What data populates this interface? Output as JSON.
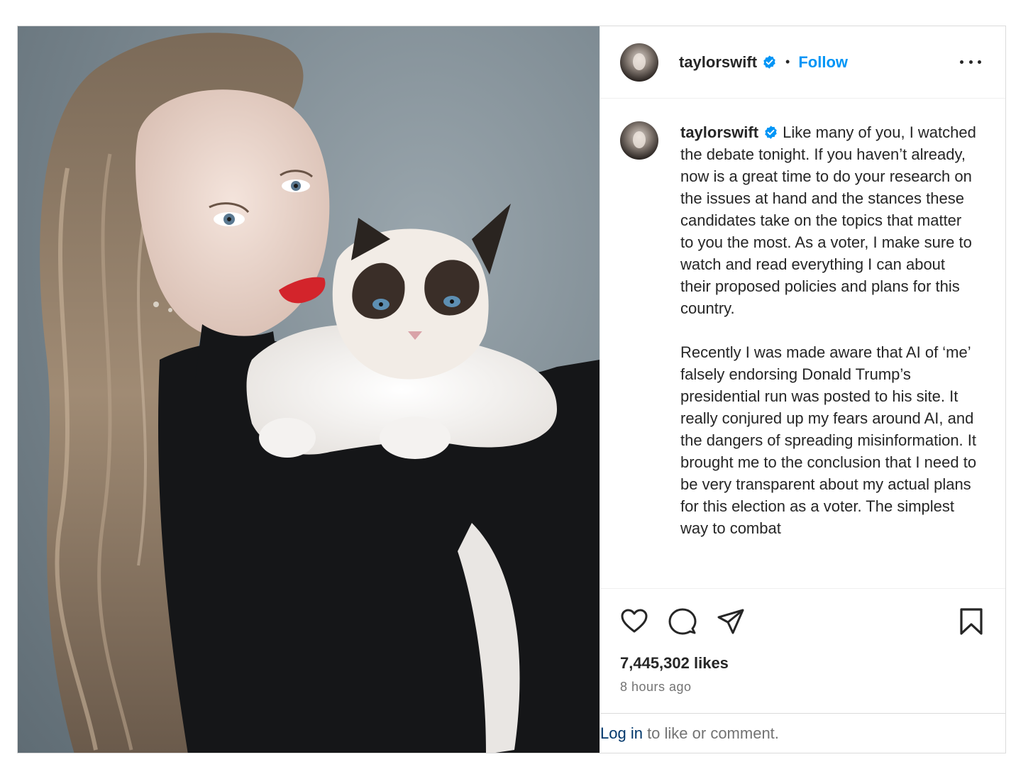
{
  "post": {
    "username": "taylorswift",
    "follow_label": "Follow",
    "separator": "•",
    "more_icon": "more-horizontal-icon",
    "photo_alt": "Photo of a woman with long wavy hair holding a fluffy cat"
  },
  "caption": {
    "username": "taylorswift",
    "paragraph1": "Like many of you, I watched the debate tonight. If you haven’t already, now is a great time to do your research on the issues at hand and the stances these candidates take on the topics that matter to you the most. As a voter, I make sure to watch and read everything I can about their proposed policies and plans for this country.",
    "paragraph2": "Recently I was made aware that AI of ‘me’ falsely endorsing Donald Trump’s presidential run was posted to his site. It really conjured up my fears around AI, and the dangers of spreading misinformation. It brought me to the conclusion that I need to be very transparent about my actual plans for this election as a voter. The simplest way to combat"
  },
  "actions": {
    "icons": [
      "heart-icon",
      "comment-icon",
      "share-icon",
      "bookmark-icon"
    ]
  },
  "stats": {
    "likes": "7,445,302 likes",
    "time_ago": "8 hours ago"
  },
  "login": {
    "link_label": "Log in",
    "rest_text": " to like or comment."
  },
  "colors": {
    "accent": "#0095f6",
    "link_dark": "#00376b",
    "text": "#262626",
    "muted": "#737373",
    "border": "#dbdbdb"
  }
}
